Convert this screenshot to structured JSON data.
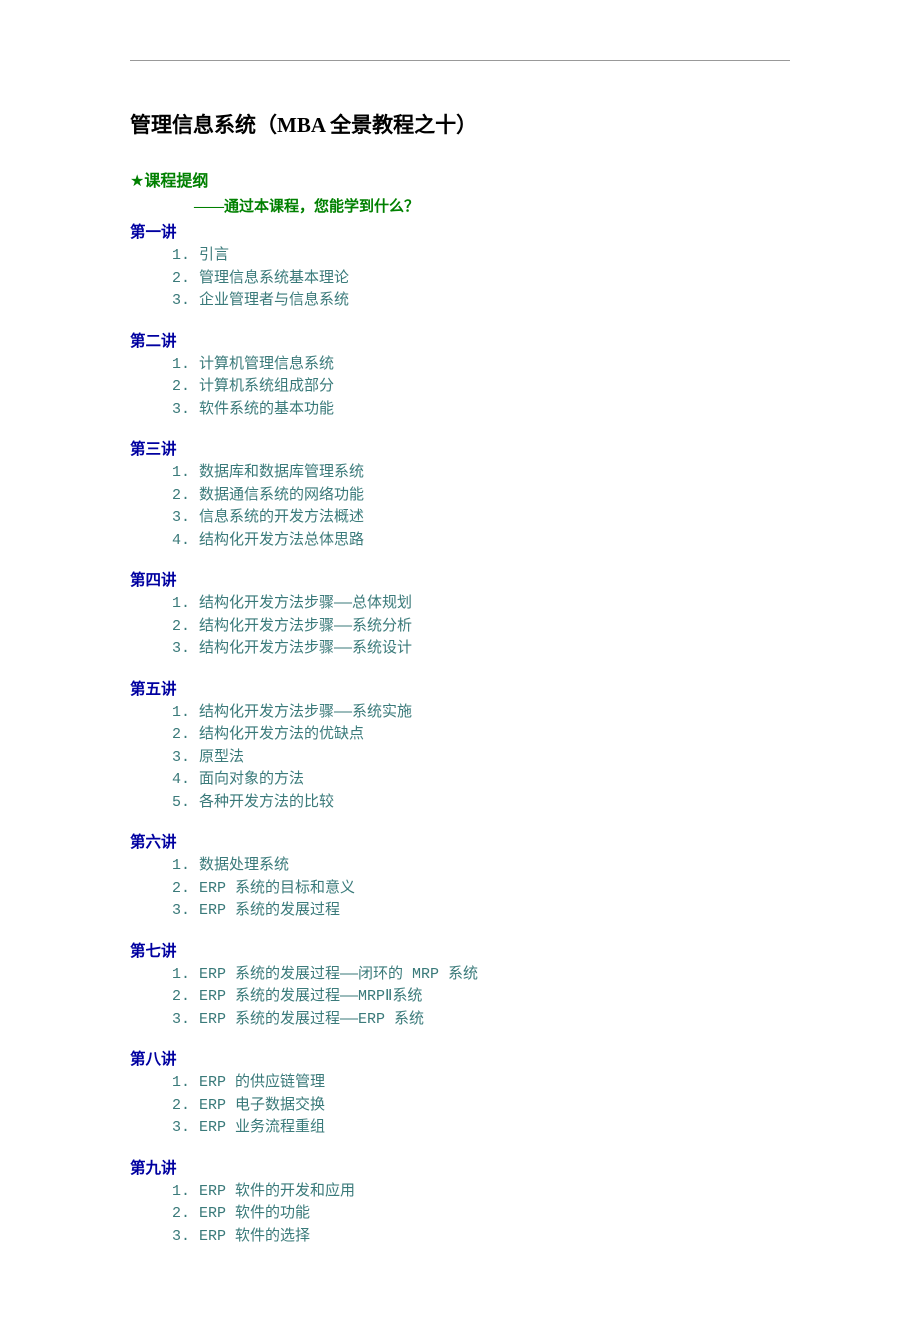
{
  "title": "管理信息系统（MBA 全景教程之十）",
  "outline": {
    "star": "★",
    "label": "课程提纲",
    "subtitle": "——通过本课程，您能学到什么？"
  },
  "sections": [
    {
      "title": "第一讲",
      "items": [
        "1. 引言",
        "2. 管理信息系统基本理论",
        "3. 企业管理者与信息系统"
      ]
    },
    {
      "title": "第二讲",
      "items": [
        "1. 计算机管理信息系统",
        "2. 计算机系统组成部分",
        "3. 软件系统的基本功能"
      ]
    },
    {
      "title": "第三讲",
      "items": [
        "1. 数据库和数据库管理系统",
        "2. 数据通信系统的网络功能",
        "3. 信息系统的开发方法概述",
        "4. 结构化开发方法总体思路"
      ]
    },
    {
      "title": "第四讲",
      "items": [
        "1. 结构化开发方法步骤——总体规划",
        "2. 结构化开发方法步骤——系统分析",
        "3. 结构化开发方法步骤——系统设计"
      ]
    },
    {
      "title": "第五讲",
      "items": [
        "1. 结构化开发方法步骤——系统实施",
        "2. 结构化开发方法的优缺点",
        "3. 原型法",
        "4. 面向对象的方法",
        "5. 各种开发方法的比较"
      ]
    },
    {
      "title": "第六讲",
      "items": [
        "1. 数据处理系统",
        "2. ERP 系统的目标和意义",
        "3. ERP 系统的发展过程"
      ]
    },
    {
      "title": "第七讲",
      "items": [
        "1. ERP 系统的发展过程——闭环的 MRP 系统",
        "2. ERP 系统的发展过程——MRPⅡ系统",
        "3. ERP 系统的发展过程——ERP 系统"
      ]
    },
    {
      "title": "第八讲",
      "items": [
        "1. ERP 的供应链管理",
        "2. ERP 电子数据交换",
        "3. ERP 业务流程重组"
      ]
    },
    {
      "title": "第九讲",
      "items": [
        "1. ERP 软件的开发和应用",
        "2. ERP 软件的功能",
        "3. ERP 软件的选择"
      ]
    }
  ]
}
